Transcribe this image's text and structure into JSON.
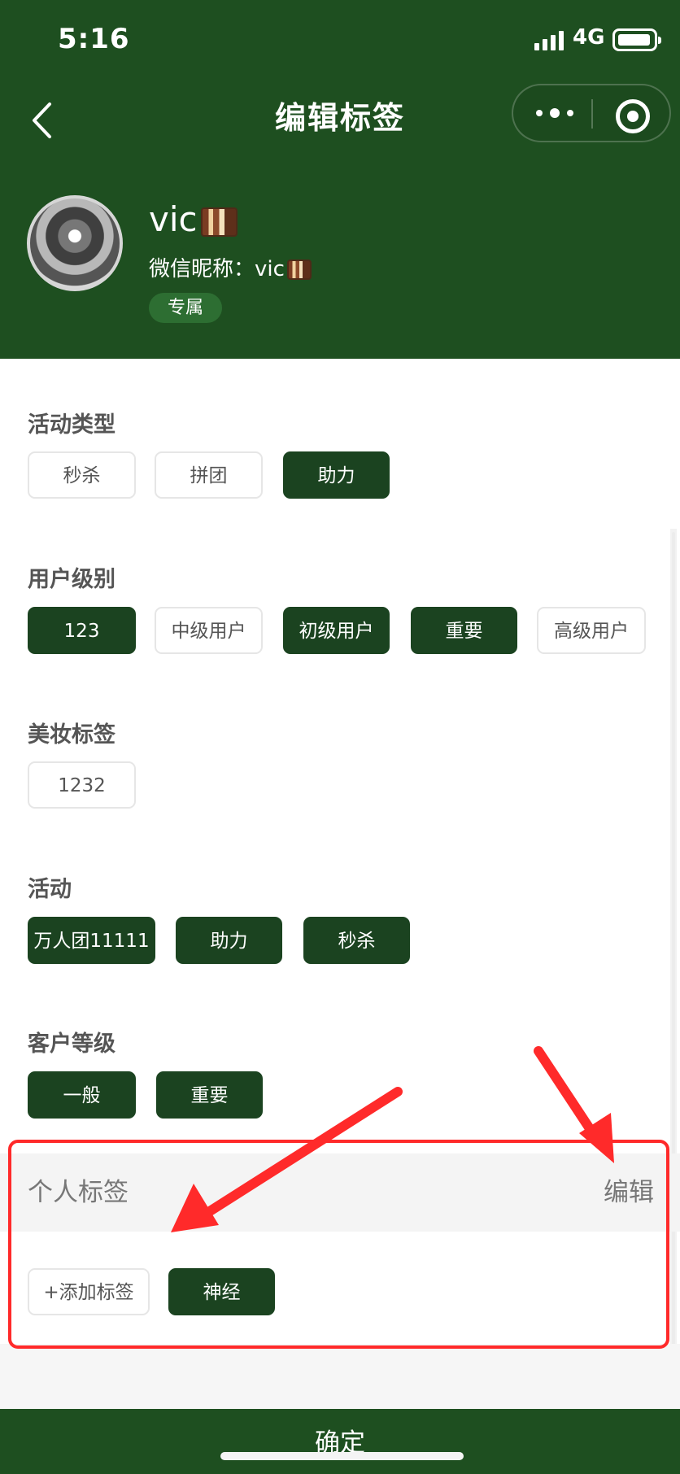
{
  "status_bar": {
    "time": "5:16",
    "network": "4G"
  },
  "nav": {
    "title": "编辑标签"
  },
  "profile": {
    "name": "vic",
    "wechat_nickname": "微信昵称：vic",
    "badge": "专属"
  },
  "sections": [
    {
      "title": "活动类型",
      "tags": [
        {
          "label": "秒杀",
          "selected": false
        },
        {
          "label": "拼团",
          "selected": false
        },
        {
          "label": "助力",
          "selected": true
        }
      ]
    },
    {
      "title": "用户级别",
      "tags": [
        {
          "label": "123",
          "selected": true
        },
        {
          "label": "中级用户",
          "selected": false
        },
        {
          "label": "初级用户",
          "selected": true
        },
        {
          "label": "重要",
          "selected": true
        },
        {
          "label": "高级用户",
          "selected": false
        }
      ]
    },
    {
      "title": "美妆标签",
      "tags": [
        {
          "label": "1232",
          "selected": false
        }
      ]
    },
    {
      "title": "活动",
      "tags": [
        {
          "label": "万人团11111",
          "selected": true
        },
        {
          "label": "助力",
          "selected": true
        },
        {
          "label": "秒杀",
          "selected": true
        }
      ]
    },
    {
      "title": "客户等级",
      "tags": [
        {
          "label": "一般",
          "selected": true
        },
        {
          "label": "重要",
          "selected": true
        }
      ]
    }
  ],
  "personal_tags": {
    "title": "个人标签",
    "edit_label": "编辑",
    "add_label": "+添加标签",
    "tags": [
      {
        "label": "神经",
        "selected": true
      }
    ]
  },
  "footer": {
    "confirm_label": "确定"
  },
  "colors": {
    "primary": "#1e4f20",
    "tag_selected": "#1b4320",
    "annotation": "#ff2a2a"
  },
  "icons": {
    "back": "chevron-left-icon",
    "more": "more-dots-icon",
    "target": "target-icon",
    "signal": "signal-icon",
    "battery": "battery-icon"
  }
}
